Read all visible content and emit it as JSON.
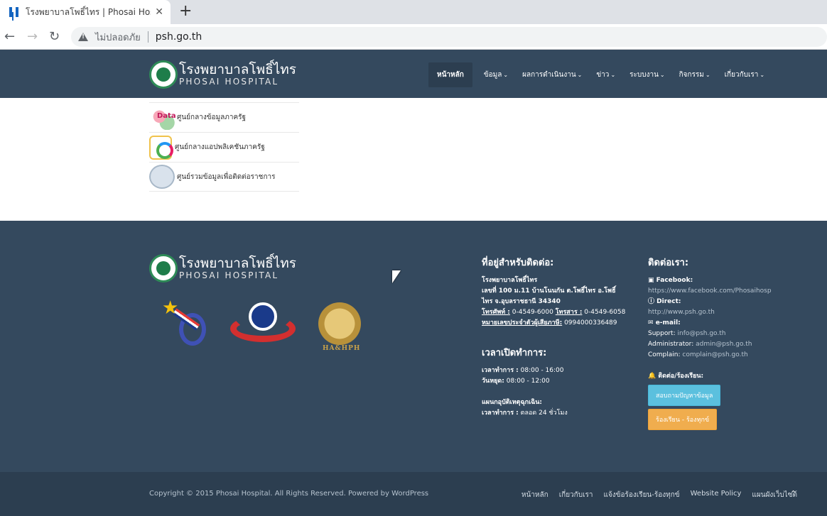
{
  "browser": {
    "tab_title": "โรงพยาบาลโพธิ์ไทร | Phosai Hospital",
    "new_tab": "+",
    "insecure_label": "ไม่ปลอดภัย",
    "url": "psh.go.th"
  },
  "site": {
    "logo_th": "โรงพยาบาลโพธิ์ไทร",
    "logo_en": "PHOSAI HOSPITAL",
    "nav": [
      {
        "label": "หน้าหลัก",
        "active": true
      },
      {
        "label": "ข้อมูล",
        "active": false
      },
      {
        "label": "ผลการดำเนินงาน",
        "active": false
      },
      {
        "label": "ข่าว",
        "active": false
      },
      {
        "label": "ระบบงาน",
        "active": false
      },
      {
        "label": "กิจกรรม",
        "active": false
      },
      {
        "label": "เกี่ยวกับเรา",
        "active": false
      }
    ]
  },
  "links": [
    {
      "label": "ศูนย์กลางข้อมูลภาครัฐ",
      "icon": "data-go-th-icon"
    },
    {
      "label": "ศูนย์กลางแอปพลิเคชันภาครัฐ",
      "icon": "gov-apps-icon"
    },
    {
      "label": "ศูนย์รวมข้อมูลเพื่อติดต่อราชการ",
      "icon": "gov-seal-icon"
    }
  ],
  "footer": {
    "badge_ha": "HA&HPH",
    "address": {
      "heading": "ที่อยู่สำหรับติดต่อ:",
      "name": "โรงพยาบาลโพธิ์ไทร",
      "line1": "เลขที่ 100 ม.11 บ้านโนนกัน ต.โพธิ์ไทร อ.โพธิ์",
      "line2": "ไทร จ.อุบลราชธานี 34340",
      "phone_label": "โทรศัพท์ :",
      "phone": "0-4549-6000",
      "fax_label": "โทรสาร :",
      "fax": "0-4549-6058",
      "taxid_label": "หมายเลขประจำตัวผู้เสียภาษี:",
      "taxid": "0994000336489"
    },
    "hours": {
      "heading": "เวลาเปิดทำการ:",
      "weekday_label": "เวลาทำการ :",
      "weekday": "08:00 - 16:00",
      "holiday_label": "วันหยุด:",
      "holiday": "08:00 - 12:00",
      "er_label": "แผนกอุบัติเหตุฉุกเฉิน:",
      "er_hours_label": "เวลาทำการ :",
      "er_hours": "ตลอด 24 ชั่วโมง"
    },
    "contact": {
      "heading": "ติดต่อเรา:",
      "facebook_label": "Facebook:",
      "facebook": "https://www.facebook.com/Phosaihosp",
      "direct_label": "Direct:",
      "direct": "http://www.psh.go.th",
      "email_label": "e-mail:",
      "support_label": "Support:",
      "support": "info@psh.go.th",
      "admin_label": "Administrator:",
      "admin": "admin@psh.go.th",
      "complain_label": "Complain:",
      "complain": "complain@psh.go.th",
      "complaint_heading": "ติดต่อ/ร้องเรียน:",
      "btn_inquiry": "สอบถามปัญหาข้อมูล",
      "btn_complaint": "ร้องเรียน - ร้องทุกข์"
    },
    "copyright": "Copyright © 2015 Phosai Hospital. All Rights Reserved. Powered by WordPress",
    "bottom_nav": [
      "หน้าหลัก",
      "เกี่ยวกับเรา",
      "แจ้งข้อร้องเรียน-ร้องทุกข์",
      "Website Policy",
      "แผนผังเว็บไซต์"
    ]
  },
  "colors": {
    "header_bg": "#34495e",
    "footer_bar_bg": "#2c3e50",
    "btn_info": "#5bc0de",
    "btn_warning": "#f0ad4e"
  }
}
